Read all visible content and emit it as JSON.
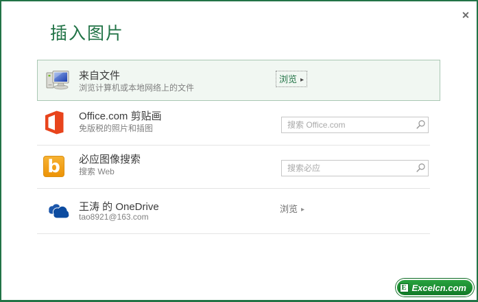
{
  "dialog": {
    "title": "插入图片",
    "close_glyph": "✕"
  },
  "colors": {
    "accent_green": "#217346",
    "selected_row_bg": "#f1f7f2",
    "selected_row_border": "#a8c7b2",
    "office_orange": "#e8441c",
    "bing_orange": "#f2a11a",
    "onedrive_blue": "#0c4ba0",
    "watermark_green": "#1d8a31"
  },
  "rows": [
    {
      "id": "from-file",
      "title": "来自文件",
      "subtitle": "浏览计算机或本地网络上的文件",
      "action_label": "浏览",
      "action_arrow": "▸"
    },
    {
      "id": "office-clipart",
      "title": "Office.com 剪贴画",
      "subtitle": "免版税的照片和插图",
      "search_placeholder": "搜索 Office.com"
    },
    {
      "id": "bing-image-search",
      "title": "必应图像搜索",
      "subtitle": "搜索 Web",
      "search_placeholder": "搜索必应"
    },
    {
      "id": "onedrive",
      "title": "王涛 的 OneDrive",
      "subtitle": "tao8921@163.com",
      "action_label": "浏览",
      "action_arrow": "▸"
    }
  ],
  "watermark": {
    "letter": "E",
    "text": "Excelcn.com"
  }
}
